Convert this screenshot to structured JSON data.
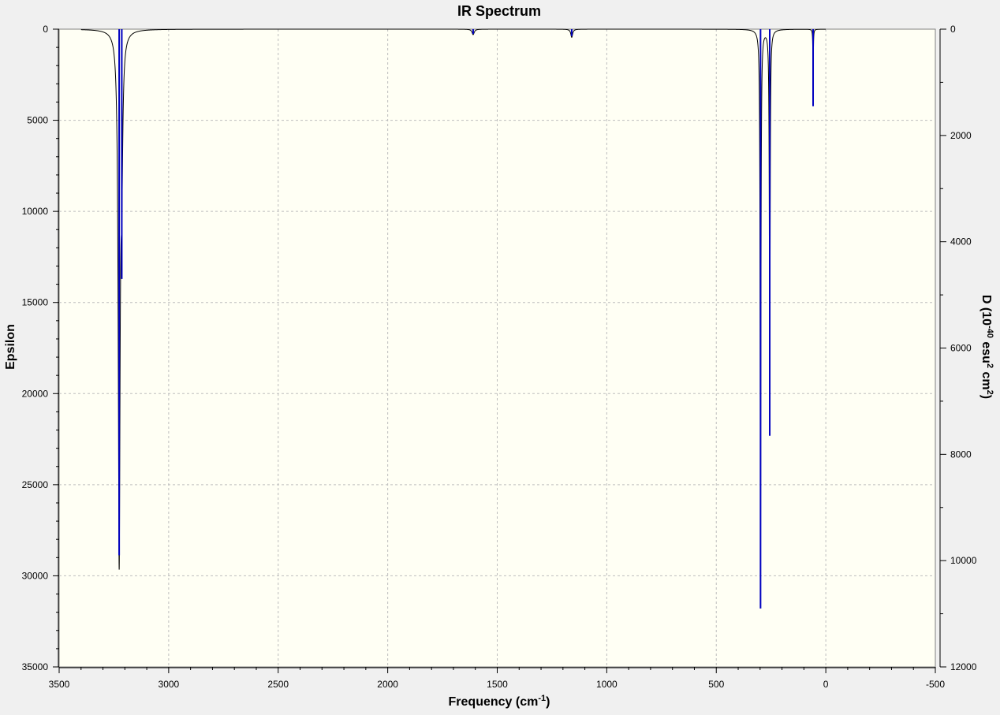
{
  "chart_data": {
    "type": "line",
    "title": "IR Spectrum",
    "xlabel": {
      "main": "Frequency (cm",
      "sup": "-1",
      "tail": ")"
    },
    "ylabel": "Epsilon",
    "y2label": {
      "a": "D (10",
      "b": "-40",
      "c": " esu",
      "d": "2",
      "e": " cm",
      "f": "2",
      "g": ")"
    },
    "xlim": [
      3500,
      -500
    ],
    "ylim": [
      0,
      35000
    ],
    "y2lim": [
      0,
      12000
    ],
    "y_inverted": true,
    "grid": true,
    "x_ticks": [
      3500,
      3000,
      2500,
      2000,
      1500,
      1000,
      500,
      0,
      -500
    ],
    "y_ticks": [
      0,
      5000,
      10000,
      15000,
      20000,
      25000,
      30000,
      35000
    ],
    "y2_ticks": [
      0,
      2000,
      4000,
      6000,
      8000,
      10000,
      12000
    ],
    "colors": {
      "plot_bg": "#fffff4",
      "grid": "#bdbdbd",
      "curve": "#000000",
      "sticks": "#0000c0"
    },
    "series": [
      {
        "kind": "spectrum",
        "peaks": [
          {
            "freq": 3226,
            "epsilon": 28700,
            "fwhm": 10
          },
          {
            "freq": 3214,
            "epsilon": 6500,
            "fwhm": 10
          },
          {
            "freq": 1610,
            "epsilon": 300,
            "fwhm": 12
          },
          {
            "freq": 1160,
            "epsilon": 450,
            "fwhm": 10
          },
          {
            "freq": 298,
            "epsilon": 30800,
            "fwhm": 4
          },
          {
            "freq": 256,
            "epsilon": 21800,
            "fwhm": 4
          },
          {
            "freq": 58,
            "epsilon": 4100,
            "fwhm": 2
          }
        ]
      },
      {
        "kind": "sticks",
        "values": [
          {
            "freq": 3226,
            "d": 9900
          },
          {
            "freq": 3214,
            "d": 4700
          },
          {
            "freq": 1610,
            "d": 90
          },
          {
            "freq": 1160,
            "d": 130
          },
          {
            "freq": 298,
            "d": 10900
          },
          {
            "freq": 256,
            "d": 7650
          },
          {
            "freq": 58,
            "d": 1450
          }
        ]
      }
    ]
  }
}
